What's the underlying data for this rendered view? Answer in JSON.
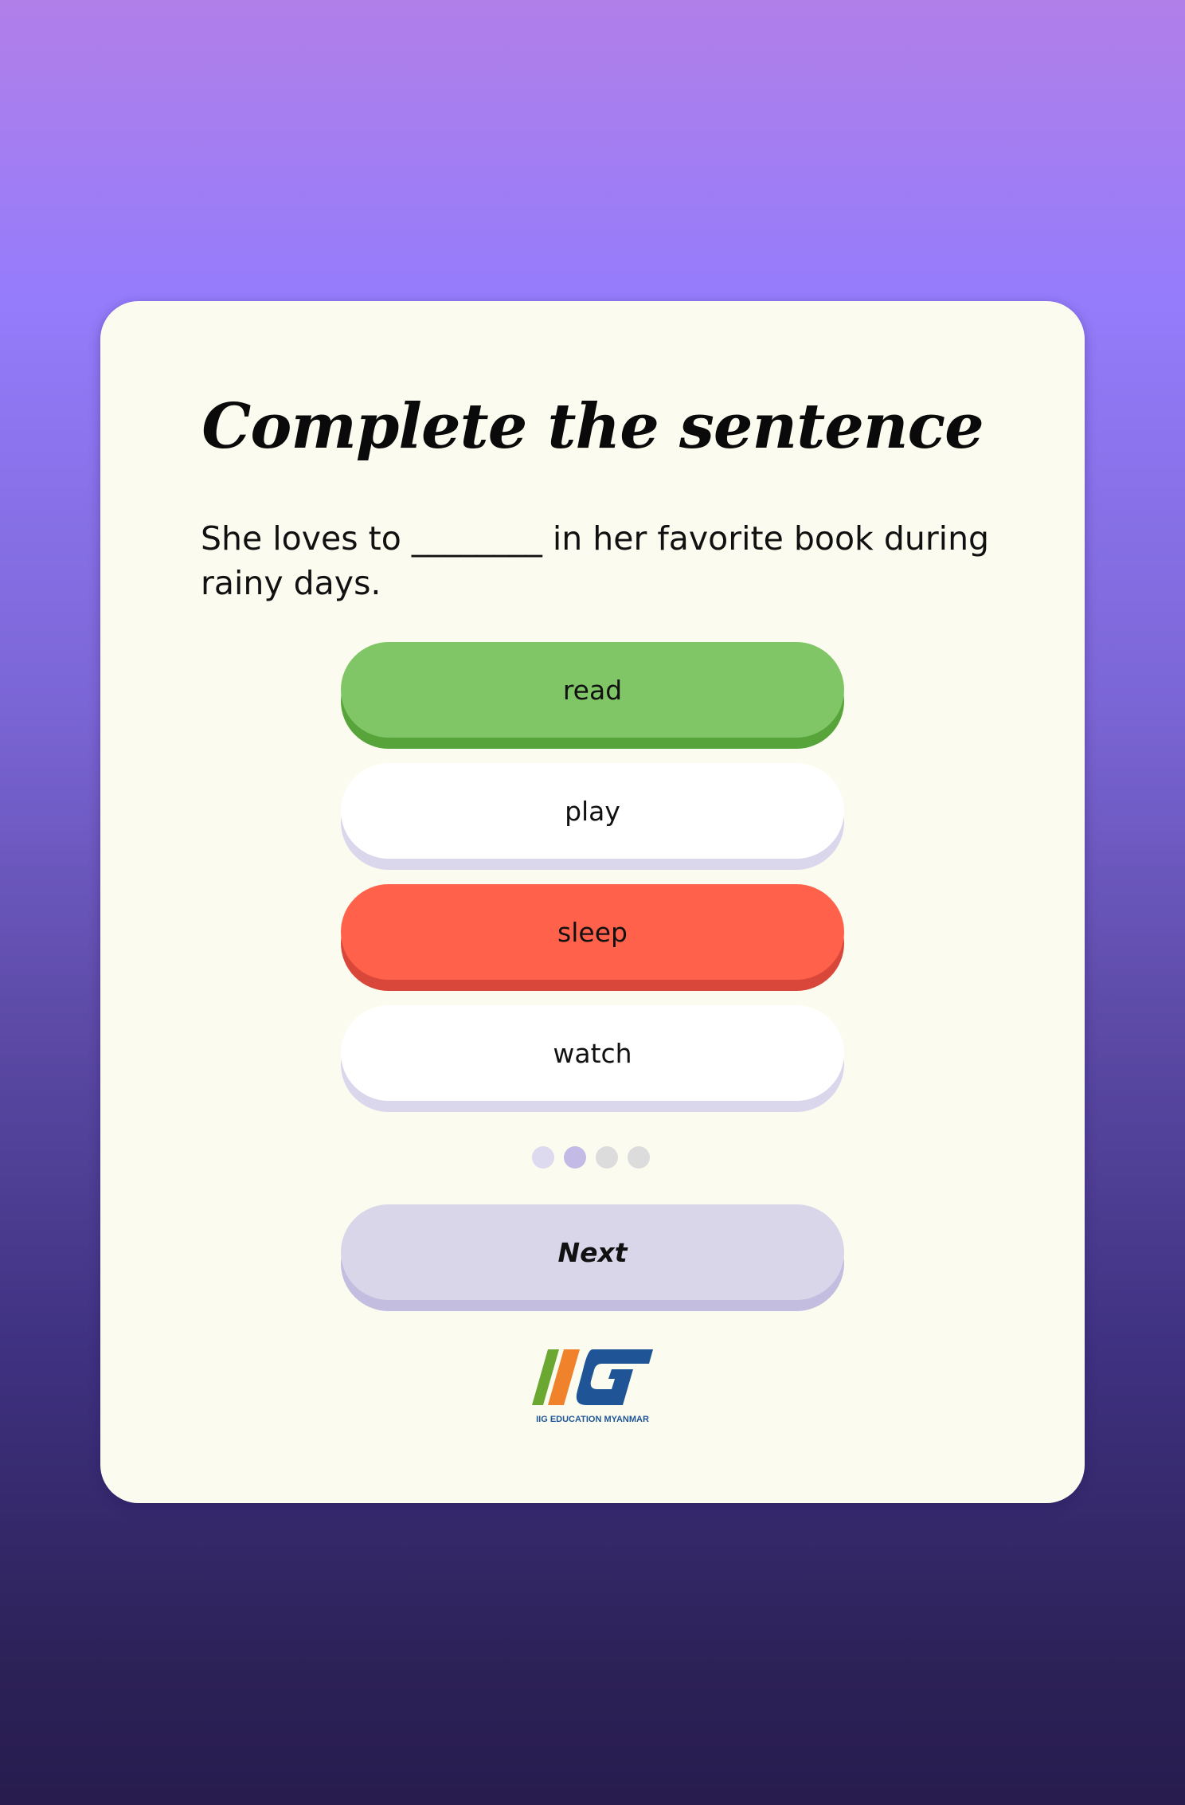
{
  "quiz": {
    "title": "Complete the sentence",
    "question": "She loves to ________ in her favorite book during rainy days.",
    "options": [
      {
        "label": "read",
        "state": "correct"
      },
      {
        "label": "play",
        "state": "neutral"
      },
      {
        "label": "sleep",
        "state": "wrong"
      },
      {
        "label": "watch",
        "state": "neutral"
      }
    ],
    "next_label": "Next"
  },
  "progress": {
    "total": 4,
    "current": 2
  },
  "brand": {
    "logo_letters": "IIG",
    "logo_caption": "IIG EDUCATION MYANMAR",
    "colors": {
      "green": "#6aa832",
      "orange": "#f0822b",
      "blue": "#1f5596"
    }
  },
  "colors": {
    "correct": "#80c667",
    "wrong": "#ff614a",
    "card_background": "#fbfcef",
    "next_button": "#d9d6ea"
  }
}
